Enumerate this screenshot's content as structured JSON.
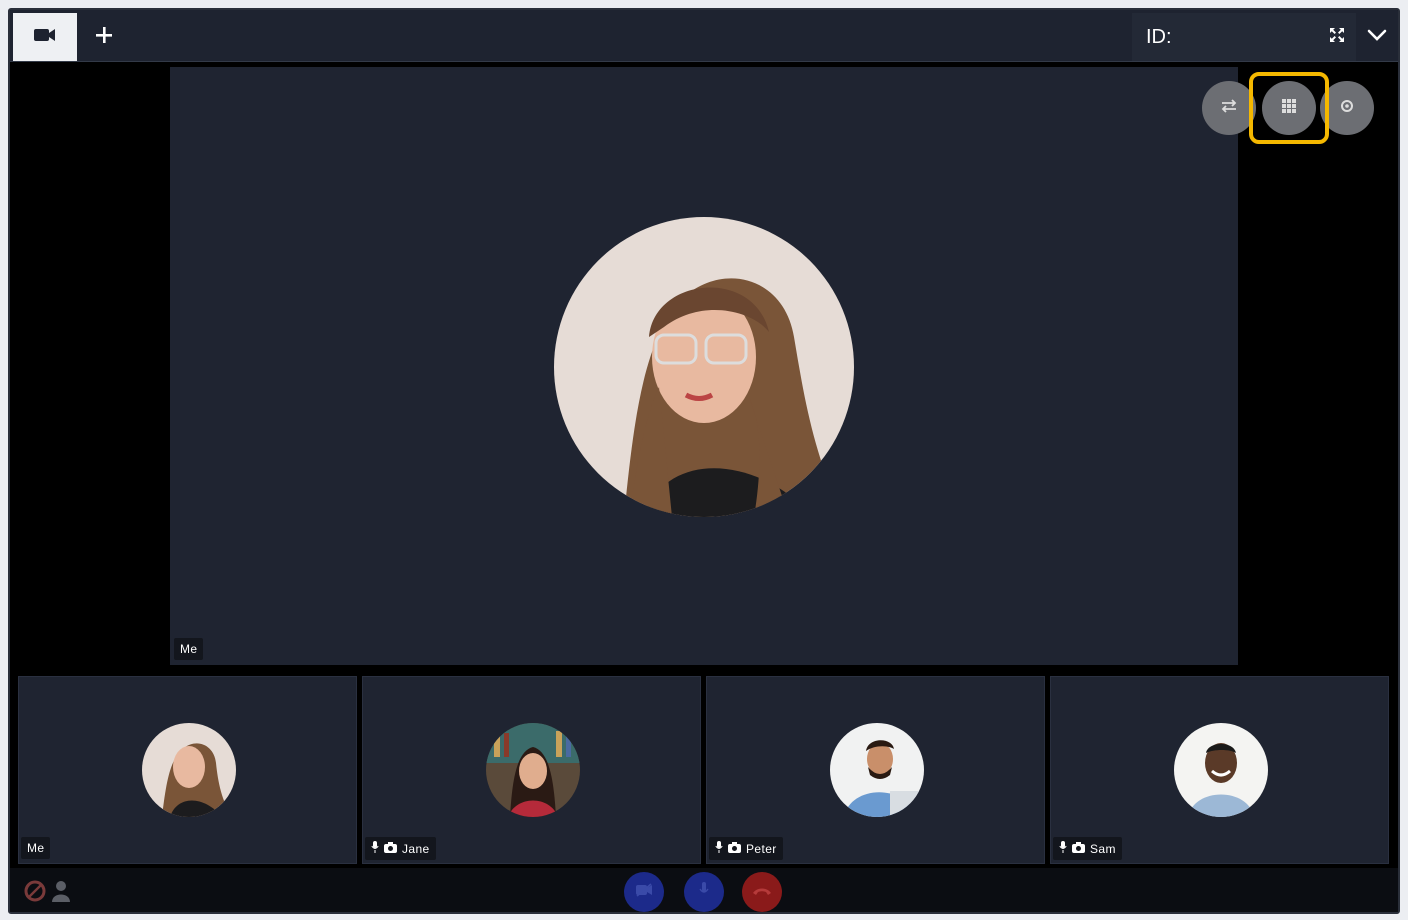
{
  "tabbar": {
    "id_label": "ID:",
    "icons": {
      "active_tab": "video-camera-icon",
      "add": "plus-icon",
      "expand": "expand-icon",
      "dropdown": "chevron-down-icon"
    }
  },
  "stage": {
    "participant_label": "Me",
    "controls": [
      "swap-icon",
      "grid-icon",
      "settings-icon"
    ],
    "highlight_color": "#f5b800"
  },
  "thumbnails": [
    {
      "name": "Me",
      "has_mic": false,
      "has_camera": false
    },
    {
      "name": "Jane",
      "has_mic": true,
      "has_camera": true
    },
    {
      "name": "Peter",
      "has_mic": true,
      "has_camera": true
    },
    {
      "name": "Sam",
      "has_mic": true,
      "has_camera": true
    }
  ],
  "bottombar": {
    "left_icons": [
      "status-icon",
      "user-icon"
    ],
    "buttons": [
      {
        "icon": "camera-off-icon",
        "color": "#1c2a8a"
      },
      {
        "icon": "mic-icon",
        "color": "#1c2a8a"
      },
      {
        "icon": "hangup-icon",
        "color": "#8a1a1a"
      }
    ]
  },
  "colors": {
    "stage_bg": "#1f2431",
    "tabbar_bg": "#1e2330"
  }
}
